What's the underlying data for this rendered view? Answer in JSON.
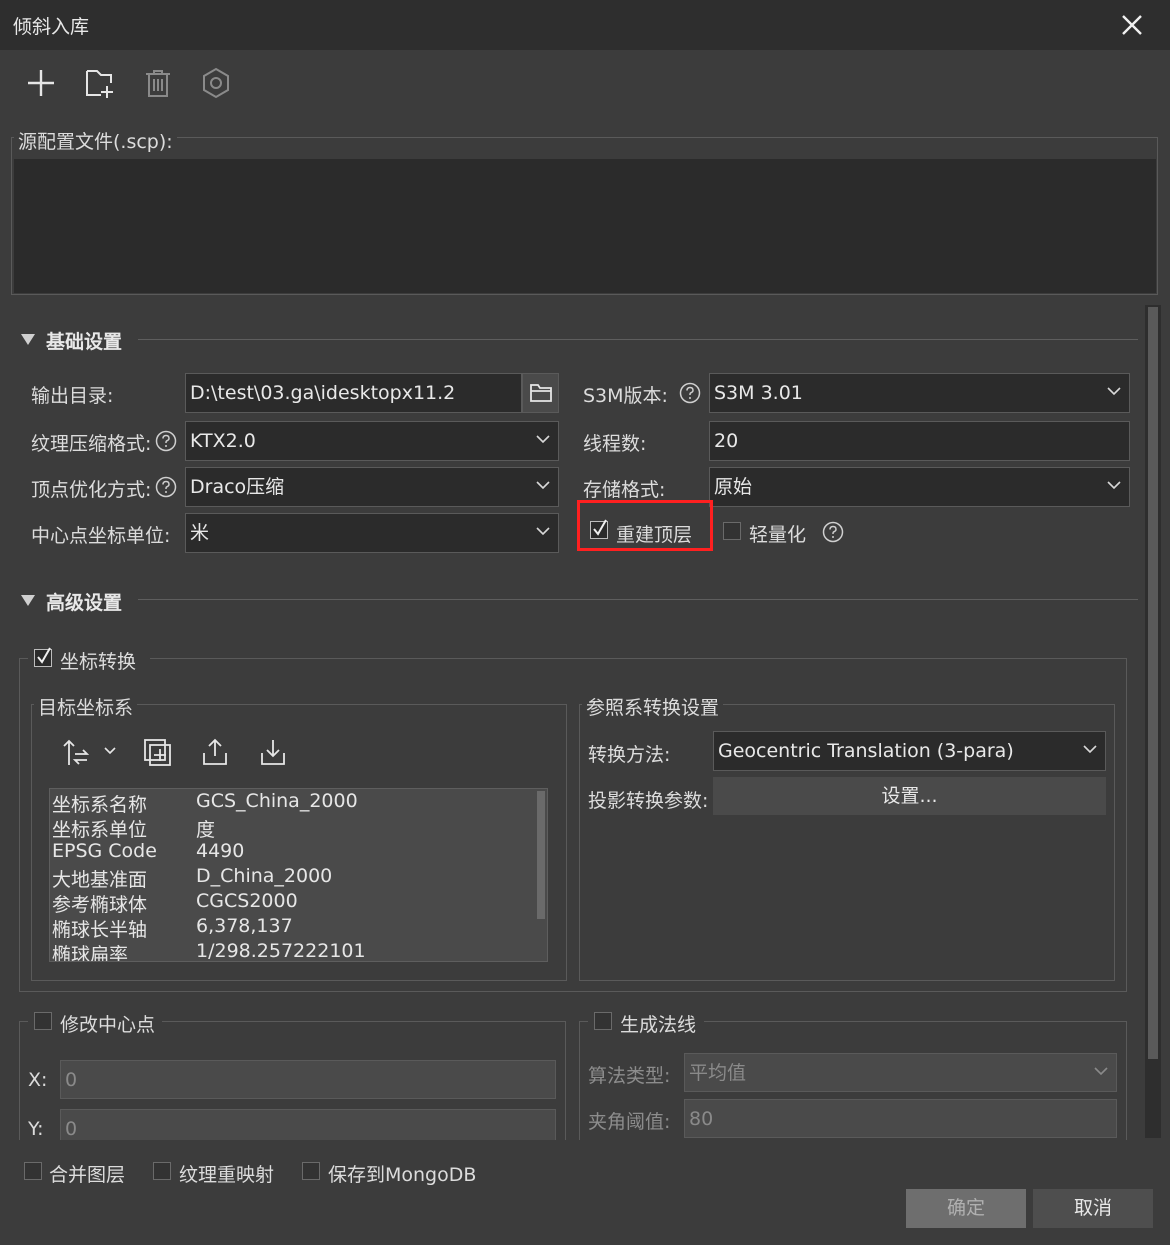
{
  "window": {
    "title": "倾斜入库"
  },
  "toolbar": {
    "add": "add-icon",
    "add_file": "add-file-icon",
    "delete": "delete-icon",
    "settings": "settings-icon"
  },
  "scp": {
    "label": "源配置文件(.scp):"
  },
  "basic": {
    "title": "基础设置",
    "output_dir_label": "输出目录:",
    "output_dir_value": "D:\\test\\03.ga\\idesktopx11.2",
    "texture_label": "纹理压缩格式:",
    "texture_value": "KTX2.0",
    "vertex_label": "顶点优化方式:",
    "vertex_value": "Draco压缩",
    "center_unit_label": "中心点坐标单位:",
    "center_unit_value": "米",
    "s3m_label": "S3M版本:",
    "s3m_value": "S3M 3.01",
    "threads_label": "线程数:",
    "threads_value": "20",
    "storage_label": "存储格式:",
    "storage_value": "原始",
    "rebuild_top_label": "重建顶层",
    "lightweight_label": "轻量化"
  },
  "advanced": {
    "title": "高级设置",
    "coord_transform_label": "坐标转换",
    "target_cs_label": "目标坐标系",
    "cs_props": [
      {
        "key": "坐标系名称",
        "value": "GCS_China_2000"
      },
      {
        "key": "坐标系单位",
        "value": "度"
      },
      {
        "key": "EPSG Code",
        "value": "4490"
      },
      {
        "key": "大地基准面",
        "value": "D_China_2000"
      },
      {
        "key": "参考椭球体",
        "value": "CGCS2000"
      },
      {
        "key": "椭球长半轴",
        "value": "6,378,137"
      },
      {
        "key": "椭球扁率",
        "value": "1/298.257222101"
      }
    ],
    "ref_transform_label": "参照系转换设置",
    "method_label": "转换方法:",
    "method_value": "Geocentric Translation (3-para)",
    "proj_params_label": "投影转换参数:",
    "settings_button": "设置...",
    "modify_center_label": "修改中心点",
    "x_label": "X:",
    "x_value": "0",
    "y_label": "Y:",
    "y_value": "0",
    "gen_normals_label": "生成法线",
    "algo_label": "算法类型:",
    "algo_value": "平均值",
    "angle_label": "夹角阈值:",
    "angle_value": "80"
  },
  "bottom": {
    "merge_layers": "合并图层",
    "texture_remap": "纹理重映射",
    "save_mongodb": "保存到MongoDB",
    "ok": "确定",
    "cancel": "取消"
  }
}
